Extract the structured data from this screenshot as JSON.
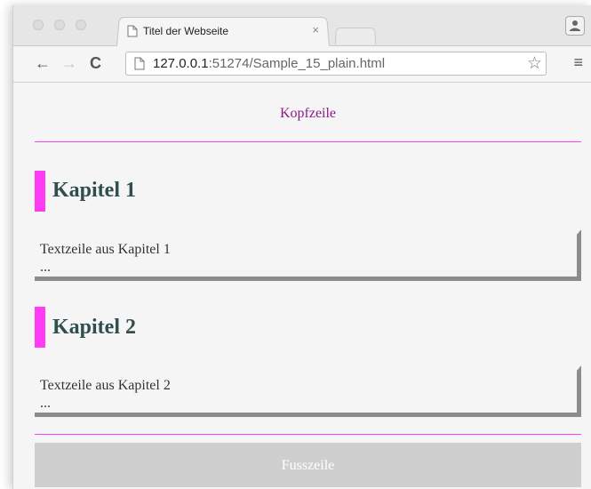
{
  "browser": {
    "tab": {
      "title": "Titel der Webseite",
      "close": "×"
    },
    "url_host": "127.0.0.1",
    "url_rest": ":51274/Sample_15_plain.html",
    "icons": {
      "back": "←",
      "forward": "→",
      "reload": "C",
      "star": "☆",
      "menu": "≡"
    }
  },
  "page": {
    "header": "Kopfzeile",
    "chapters": [
      {
        "title": "Kapitel 1",
        "line": "Textzeile aus Kapitel 1",
        "more": "..."
      },
      {
        "title": "Kapitel 2",
        "line": "Textzeile aus Kapitel 2",
        "more": "..."
      }
    ],
    "footer": "Fusszeile"
  },
  "colors": {
    "accent": "#ff3cf4",
    "header_text": "#8b1a8b",
    "heading_text": "#2f4f4f",
    "footer_bg": "#cfcfcf"
  }
}
